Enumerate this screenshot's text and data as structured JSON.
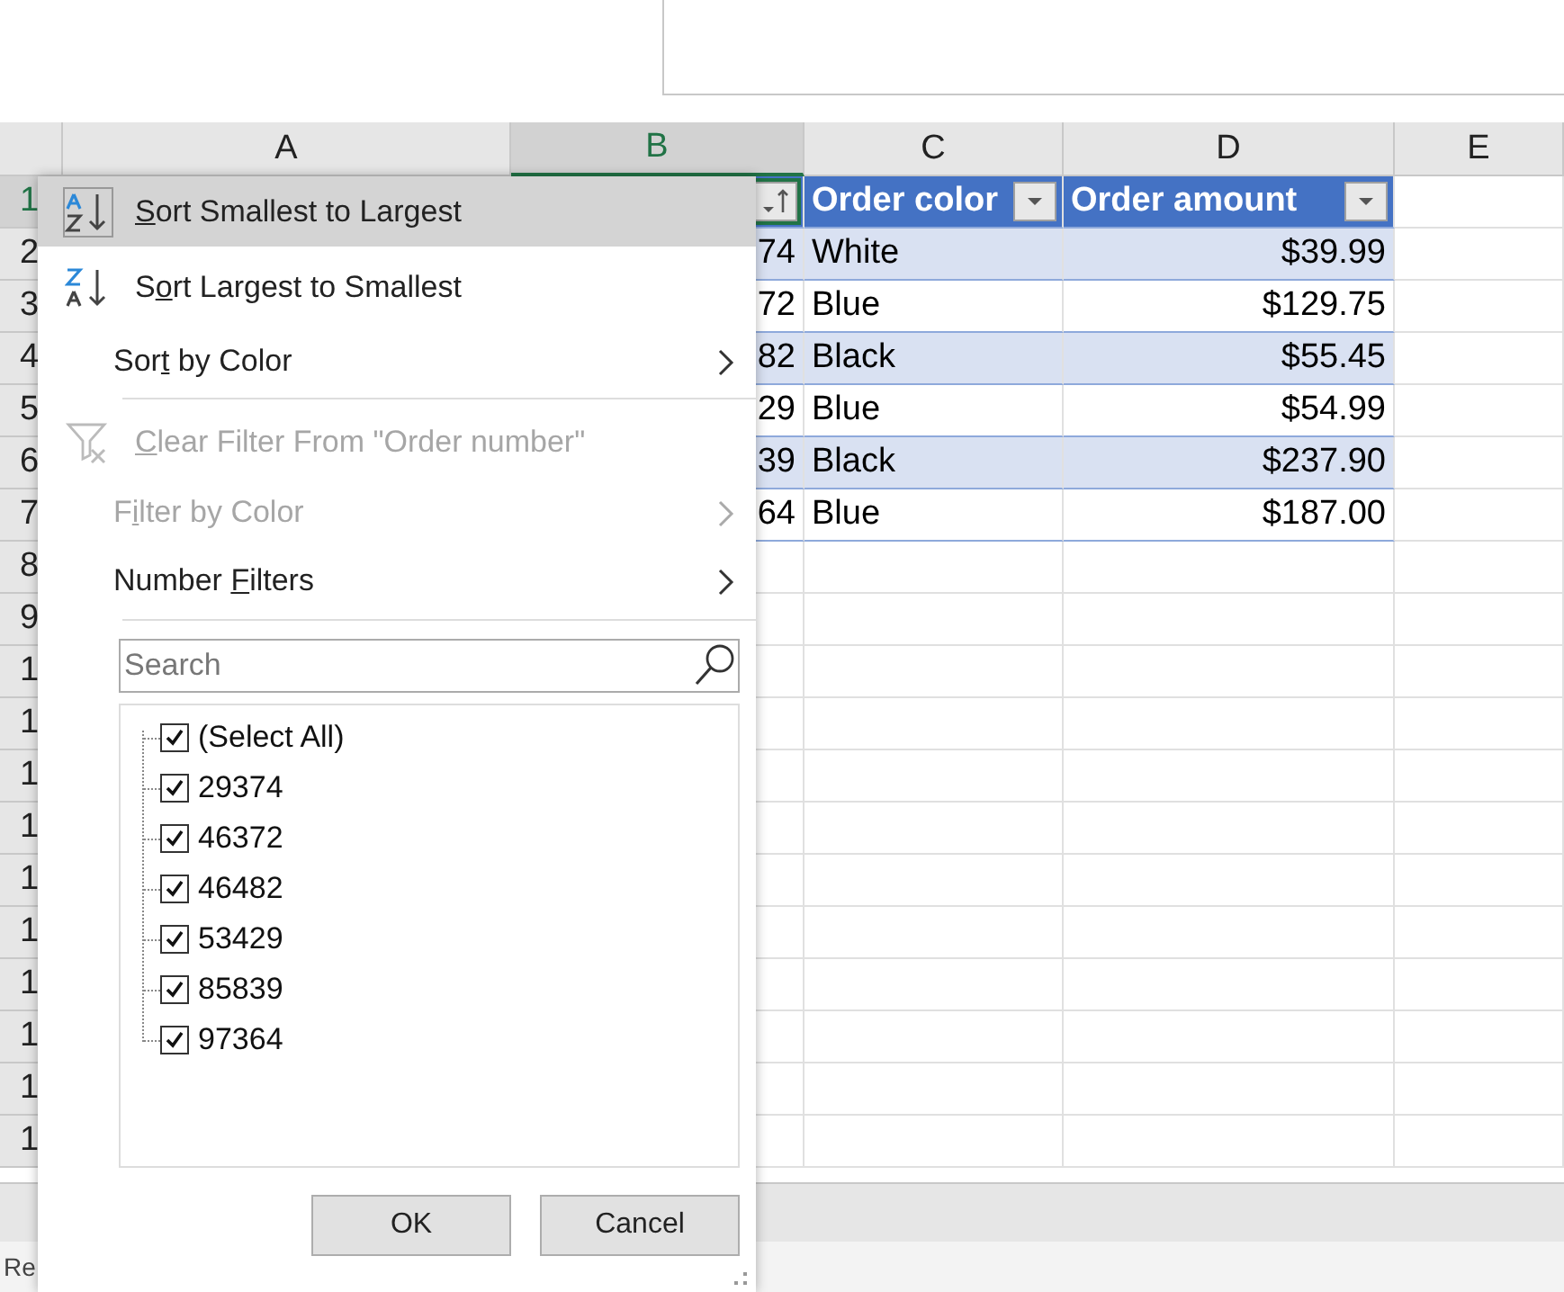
{
  "columns": [
    {
      "label": "A",
      "selected": false
    },
    {
      "label": "B",
      "selected": true
    },
    {
      "label": "C",
      "selected": false
    },
    {
      "label": "D",
      "selected": false
    },
    {
      "label": "E",
      "selected": false
    }
  ],
  "rows": [
    {
      "label": "1",
      "selected": true
    },
    {
      "label": "2",
      "selected": false
    },
    {
      "label": "3",
      "selected": false
    },
    {
      "label": "4",
      "selected": false
    },
    {
      "label": "5",
      "selected": false
    },
    {
      "label": "6",
      "selected": false
    },
    {
      "label": "7",
      "selected": false
    },
    {
      "label": "8",
      "selected": false
    },
    {
      "label": "9",
      "selected": false
    },
    {
      "label": "1",
      "selected": false
    },
    {
      "label": "1",
      "selected": false
    },
    {
      "label": "1",
      "selected": false
    },
    {
      "label": "1",
      "selected": false
    },
    {
      "label": "1",
      "selected": false
    },
    {
      "label": "1",
      "selected": false
    },
    {
      "label": "1",
      "selected": false
    },
    {
      "label": "1",
      "selected": false
    },
    {
      "label": "1",
      "selected": false
    },
    {
      "label": "1",
      "selected": false
    }
  ],
  "table": {
    "headers": [
      {
        "sorted": true
      },
      {
        "text": "Order color",
        "sorted": false
      },
      {
        "text": "Order amount",
        "sorted": false
      }
    ],
    "rows": [
      [
        "74",
        "White",
        "$39.99"
      ],
      [
        "72",
        "Blue",
        "$129.75"
      ],
      [
        "82",
        "Black",
        "$55.45"
      ],
      [
        "29",
        "Blue",
        "$54.99"
      ],
      [
        "39",
        "Black",
        "$237.90"
      ],
      [
        "64",
        "Blue",
        "$187.00"
      ]
    ]
  },
  "menu": {
    "items": [
      {
        "kind": "sort_asc",
        "key": "S",
        "post": "ort Smallest to Largest",
        "selected": true,
        "disabled": false
      },
      {
        "kind": "sort_desc",
        "pre": "S",
        "key": "o",
        "post": "rt Largest to Smallest",
        "selected": false,
        "disabled": false
      },
      {
        "kind": "submenu",
        "pre": "Sor",
        "key": "t",
        "post": " by Color",
        "selected": false,
        "disabled": false
      },
      {
        "kind": "clear_filter",
        "key": "C",
        "post": "lear Filter From \"Order number\"",
        "selected": false,
        "disabled": true
      },
      {
        "kind": "submenu",
        "pre": "F",
        "key": "i",
        "post": "lter by Color",
        "selected": false,
        "disabled": true
      },
      {
        "kind": "submenu",
        "pre": "Number ",
        "key": "F",
        "post": "ilters",
        "selected": false,
        "disabled": false
      }
    ],
    "search": {
      "placeholder": "Search"
    },
    "values": [
      {
        "label": "(Select All)",
        "checked": true
      },
      {
        "label": "29374",
        "checked": true
      },
      {
        "label": "46372",
        "checked": true
      },
      {
        "label": "46482",
        "checked": true
      },
      {
        "label": "53429",
        "checked": true
      },
      {
        "label": "85839",
        "checked": true
      },
      {
        "label": "97364",
        "checked": true
      }
    ],
    "buttons": [
      "OK",
      "Cancel"
    ]
  },
  "status_bar": {
    "text": "Re"
  }
}
